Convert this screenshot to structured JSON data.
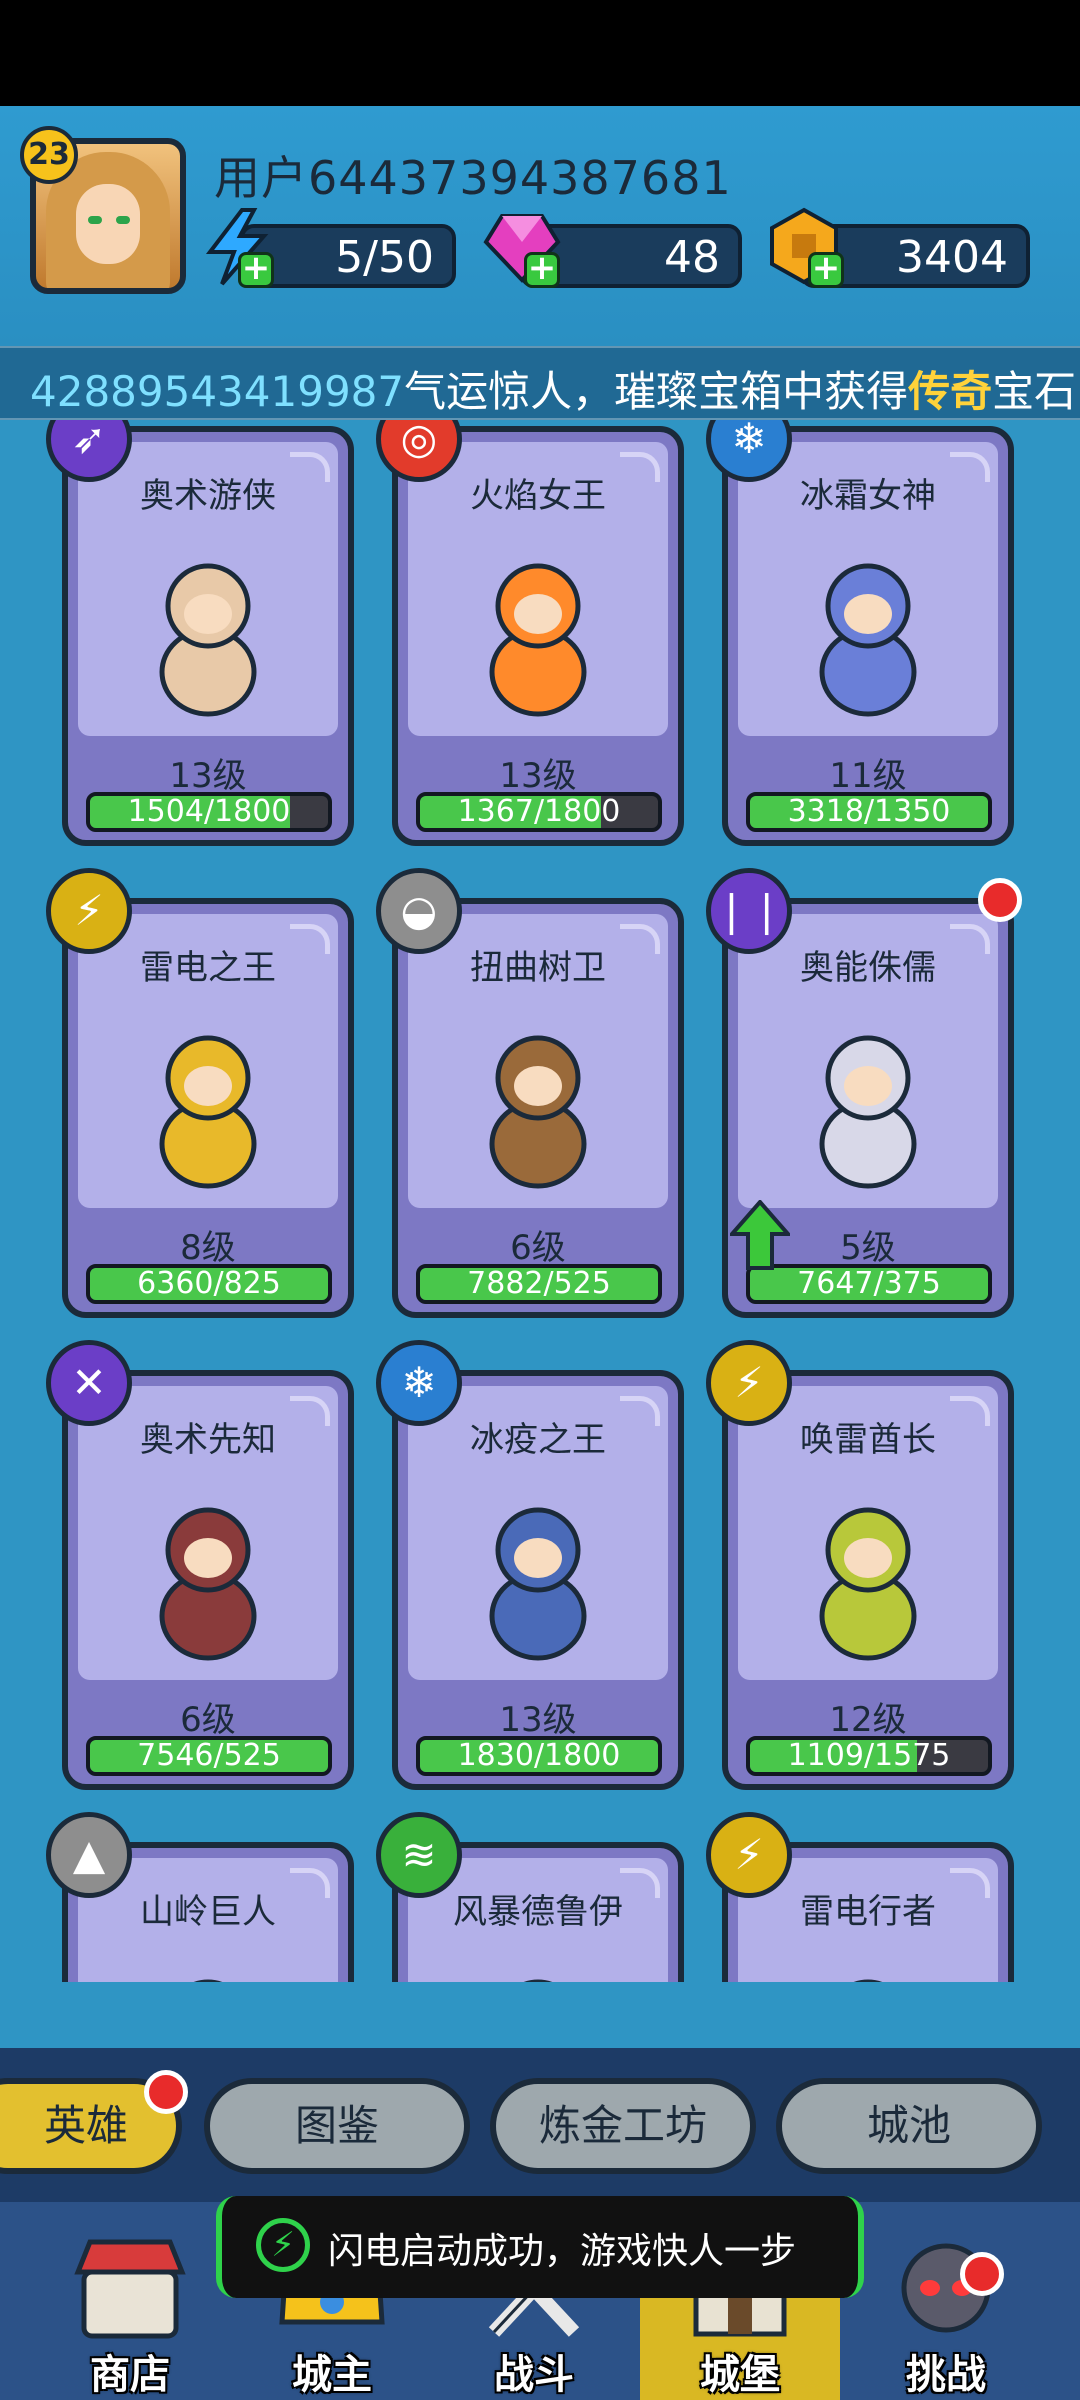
{
  "player": {
    "level": "23",
    "username": "用户64437394387681"
  },
  "resources": {
    "energy": "5/50",
    "gems": "48",
    "gold": "3404"
  },
  "ticker": {
    "player_id": "42889543419987",
    "text_before": "气运惊人，璀璨宝箱中获得",
    "highlight": "传奇",
    "text_after": "宝石"
  },
  "heroes": [
    {
      "name": "奥术游侠",
      "level": "13级",
      "progress": "1504/1800",
      "fill": 0.84,
      "emblem_color": "#6b3ec7",
      "emblem_icon": "arrow-emblem"
    },
    {
      "name": "火焰女王",
      "level": "13级",
      "progress": "1367/1800",
      "fill": 0.76,
      "emblem_color": "#e23b2b",
      "emblem_icon": "target-emblem"
    },
    {
      "name": "冰霜女神",
      "level": "11级",
      "progress": "3318/1350",
      "fill": 1.0,
      "emblem_color": "#2a7fd1",
      "emblem_icon": "ice-emblem"
    },
    {
      "name": "雷电之王",
      "level": "8级",
      "progress": "6360/825",
      "fill": 1.0,
      "emblem_color": "#d9b114",
      "emblem_icon": "lightning-emblem"
    },
    {
      "name": "扭曲树卫",
      "level": "6级",
      "progress": "7882/525",
      "fill": 1.0,
      "emblem_color": "#8e8e8e",
      "emblem_icon": "shield-emblem"
    },
    {
      "name": "奥能侏儒",
      "level": "5级",
      "progress": "7647/375",
      "fill": 1.0,
      "emblem_color": "#6b3ec7",
      "emblem_icon": "claw-emblem"
    },
    {
      "name": "奥术先知",
      "level": "6级",
      "progress": "7546/525",
      "fill": 1.0,
      "emblem_color": "#6b3ec7",
      "emblem_icon": "arrows-emblem"
    },
    {
      "name": "冰疫之王",
      "level": "13级",
      "progress": "1830/1800",
      "fill": 1.0,
      "emblem_color": "#2a7fd1",
      "emblem_icon": "crystal-emblem"
    },
    {
      "name": "唤雷酋长",
      "level": "12级",
      "progress": "1109/1575",
      "fill": 0.7,
      "emblem_color": "#d9b114",
      "emblem_icon": "lightning-emblem"
    },
    {
      "name": "山岭巨人",
      "level": "",
      "progress": "",
      "fill": 0,
      "emblem_color": "#8e8e8e",
      "emblem_icon": "rock-emblem"
    },
    {
      "name": "风暴德鲁伊",
      "level": "",
      "progress": "",
      "fill": 0,
      "emblem_color": "#39b03b",
      "emblem_icon": "tornado-emblem"
    },
    {
      "name": "雷电行者",
      "level": "",
      "progress": "",
      "fill": 0,
      "emblem_color": "#d9b114",
      "emblem_icon": "lightning-emblem"
    }
  ],
  "subnav": {
    "heroes": "英雄",
    "codex": "图鉴",
    "alchemy": "炼金工坊",
    "city": "城池"
  },
  "tabs": {
    "shop": "商店",
    "lord": "城主",
    "battle": "战斗",
    "castle": "城堡",
    "challenge": "挑战"
  },
  "toast": {
    "text": "闪电启动成功，游戏快人一步"
  }
}
